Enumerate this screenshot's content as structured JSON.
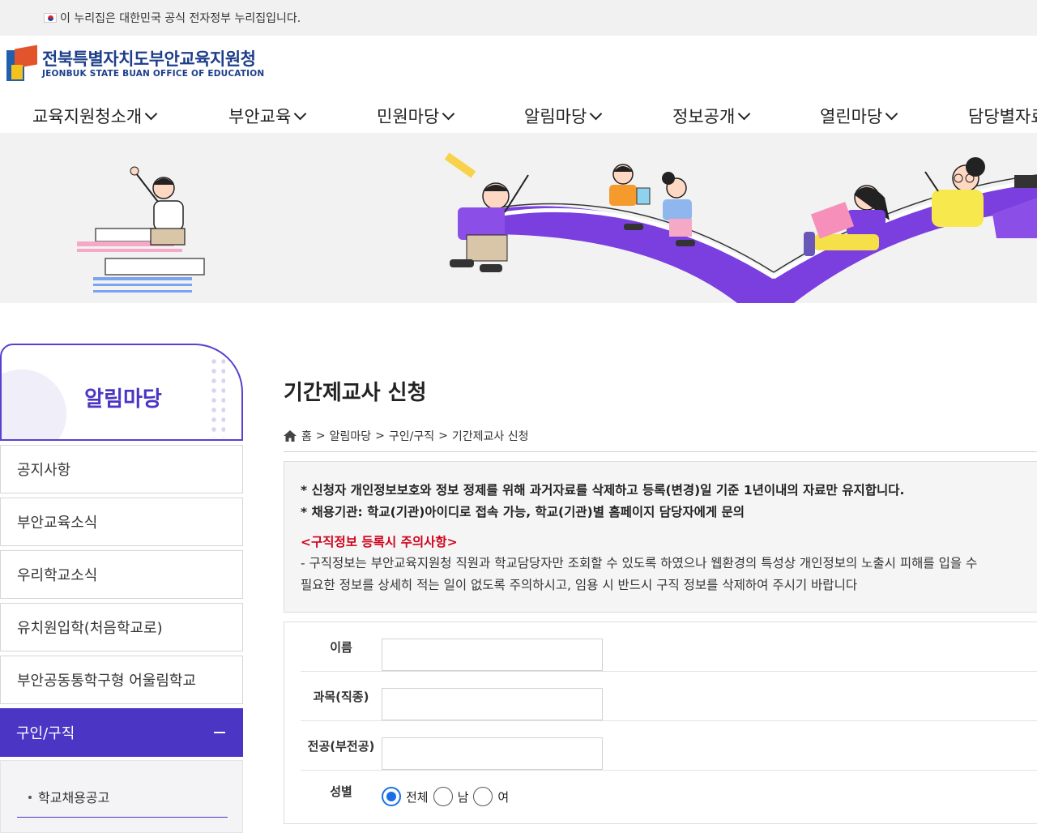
{
  "govbar": {
    "text": "이 누리집은 대한민국 공식 전자정부 누리집입니다."
  },
  "logo": {
    "ko": "전북특별자치도부안교육지원청",
    "en": "JEONBUK STATE BUAN OFFICE OF EDUCATION"
  },
  "gnb": [
    "교육지원청소개",
    "부안교육",
    "민원마당",
    "알림마당",
    "정보공개",
    "열린마당",
    "담당별자료"
  ],
  "sidebar": {
    "title": "알림마당",
    "items": [
      "공지사항",
      "부안교육소식",
      "우리학교소식",
      "유치원입학(처음학교로)",
      "부안공동통학구형 어울림학교"
    ],
    "active": "구인/구직",
    "sub_items": [
      "학교채용공고"
    ]
  },
  "page": {
    "title": "기간제교사 신청",
    "breadcrumb": [
      "홈",
      "알림마당",
      "구인/구직",
      "기간제교사 신청"
    ]
  },
  "notice": {
    "line1": "* 신청자 개인정보보호와 정보 정제를 위해 과거자료를 삭제하고 등록(변경)일 기준 1년이내의 자료만 유지합니다.",
    "line2": "* 채용기관: 학교(기관)아이디로 접속 가능, 학교(기관)별 홈페이지 담당자에게 문의",
    "caution_title": "<구직정보 등록시 주의사항>",
    "caution_line1": "- 구직정보는 부안교육지원청 직원과 학교담당자만 조회할 수 있도록 하였으나 웹환경의 특성상 개인정보의 노출시 피해를 입을 수",
    "caution_line2": "필요한 정보를 상세히 적는 일이 없도록 주의하시고, 임용 시 반드시 구직 정보를 삭제하여 주시기 바랍니다"
  },
  "form": {
    "name_label": "이름",
    "subject_label": "과목(직종)",
    "major_label": "전공(부전공)",
    "gender_label": "성별",
    "gender_options": [
      "전체",
      "남",
      "여"
    ],
    "gender_selected": "전체"
  },
  "colors": {
    "primary": "#4a35c4",
    "notice_red": "#d0021b",
    "radio_blue": "#1a6ee8"
  }
}
